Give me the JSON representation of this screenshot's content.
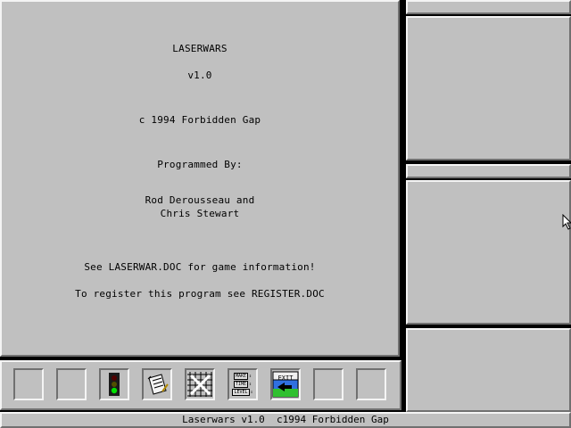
{
  "main": {
    "title": "LASERWARS",
    "version": "v1.0",
    "copyright": "c 1994 Forbidden Gap",
    "programmed_by": "Programmed By:",
    "author1": "Rod Derousseau and",
    "author2": "Chris Stewart",
    "doc_info": "See LASERWAR.DOC for game information!",
    "register_info": "To register this program see REGISTER.DOC"
  },
  "toolbar": {
    "mini_labels": [
      "MAKE",
      "TIME",
      "LEVEL"
    ],
    "exit_label": "EXIT",
    "icons": [
      "empty-slot-icon",
      "empty-slot-icon",
      "traffic-light-icon",
      "notepad-icon",
      "grid-icon",
      "options-icon",
      "exit-icon",
      "empty-slot-icon",
      "empty-slot-icon"
    ]
  },
  "status_bar": {
    "text": "Laserwars v1.0  c1994 Forbidden Gap"
  }
}
